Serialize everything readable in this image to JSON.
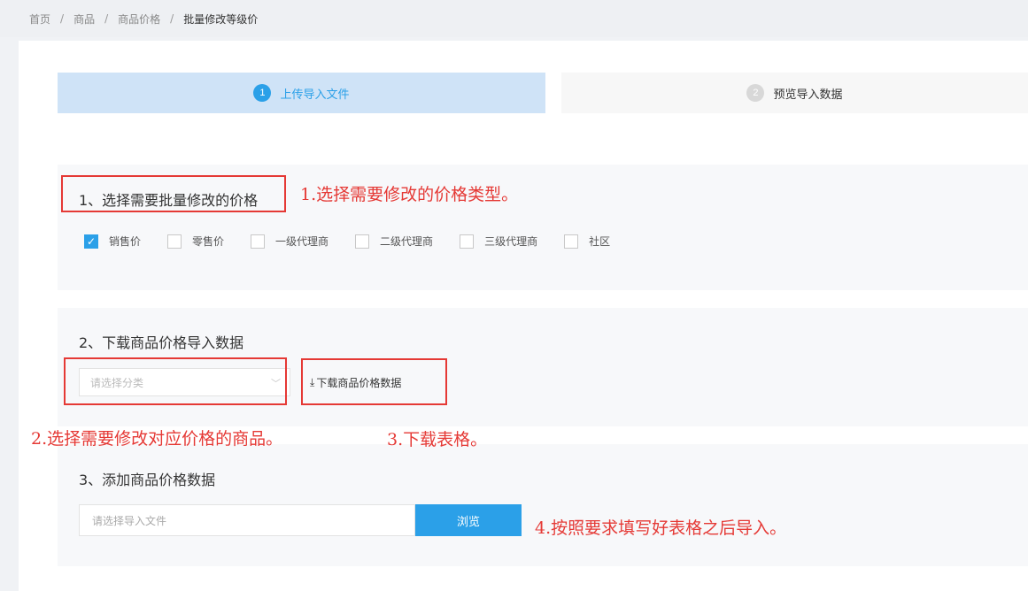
{
  "breadcrumb": {
    "items": [
      "首页",
      "商品",
      "商品价格",
      "批量修改等级价"
    ],
    "separator": "/"
  },
  "steps": [
    {
      "number": "1",
      "label": "上传导入文件",
      "active": true
    },
    {
      "number": "2",
      "label": "预览导入数据",
      "active": false
    }
  ],
  "section1": {
    "title": "1、选择需要批量修改的价格",
    "options": [
      {
        "label": "销售价",
        "checked": true
      },
      {
        "label": "零售价",
        "checked": false
      },
      {
        "label": "一级代理商",
        "checked": false
      },
      {
        "label": "二级代理商",
        "checked": false
      },
      {
        "label": "三级代理商",
        "checked": false
      },
      {
        "label": "社区",
        "checked": false
      }
    ]
  },
  "section2": {
    "title": "2、下载商品价格导入数据",
    "select_placeholder": "请选择分类",
    "download_label": "下载商品价格数据"
  },
  "section3": {
    "title": "3、添加商品价格数据",
    "file_placeholder": "请选择导入文件",
    "browse_label": "浏览"
  },
  "annotations": {
    "note1": "1.选择需要修改的价格类型。",
    "note2": "2.选择需要修改对应价格的商品。",
    "note3": "3.下载表格。",
    "note4": "4.按照要求填写好表格之后导入。"
  },
  "colors": {
    "accent": "#2ba0e8",
    "annotation_red": "#e53935"
  }
}
